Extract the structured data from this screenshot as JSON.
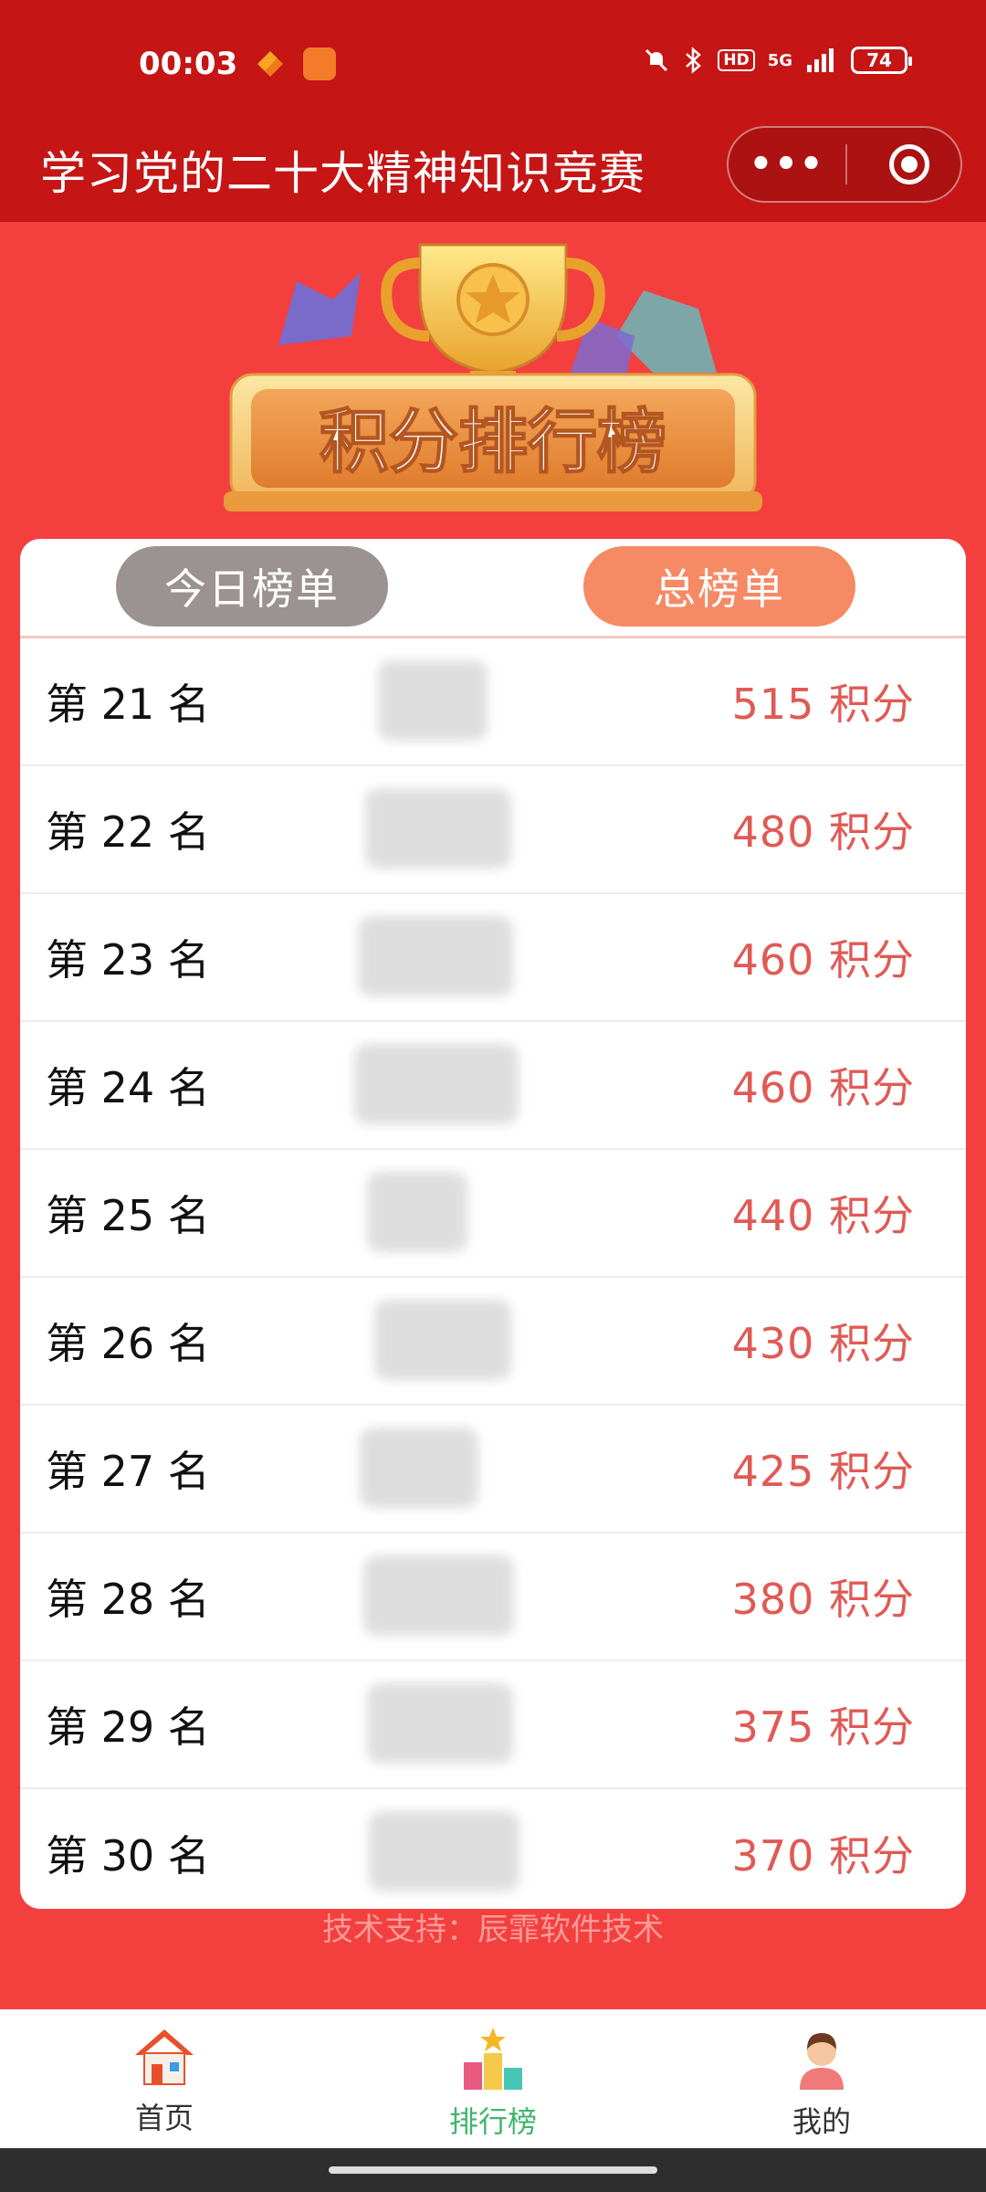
{
  "status_bar": {
    "time": "00:03",
    "battery": "74",
    "hd": "HD",
    "network": "5G"
  },
  "header": {
    "title": "学习党的二十大精神知识竞赛",
    "menu_dots": "•••"
  },
  "banner": {
    "text": "积分排行榜"
  },
  "tabs": [
    {
      "label": "今日榜单",
      "active": false
    },
    {
      "label": "总榜单",
      "active": true
    }
  ],
  "rows": [
    {
      "rank": "第 21 名",
      "score": "515 积分"
    },
    {
      "rank": "第 22 名",
      "score": "480 积分"
    },
    {
      "rank": "第 23 名",
      "score": "460 积分"
    },
    {
      "rank": "第 24 名",
      "score": "460 积分"
    },
    {
      "rank": "第 25 名",
      "score": "440 积分"
    },
    {
      "rank": "第 26 名",
      "score": "430 积分"
    },
    {
      "rank": "第 27 名",
      "score": "425 积分"
    },
    {
      "rank": "第 28 名",
      "score": "380 积分"
    },
    {
      "rank": "第 29 名",
      "score": "375 积分"
    },
    {
      "rank": "第 30 名",
      "score": "370 积分"
    }
  ],
  "footer_note": "技术支持：辰霏软件技术",
  "nav": [
    {
      "label": "首页",
      "icon": "home-icon"
    },
    {
      "label": "排行榜",
      "icon": "podium-icon",
      "active": true
    },
    {
      "label": "我的",
      "icon": "user-icon"
    }
  ],
  "colors": {
    "header": "#c51515",
    "background": "#f43f3f",
    "accent": "#f58a65",
    "score": "#e05a55",
    "nav_active": "#3fb56b"
  }
}
